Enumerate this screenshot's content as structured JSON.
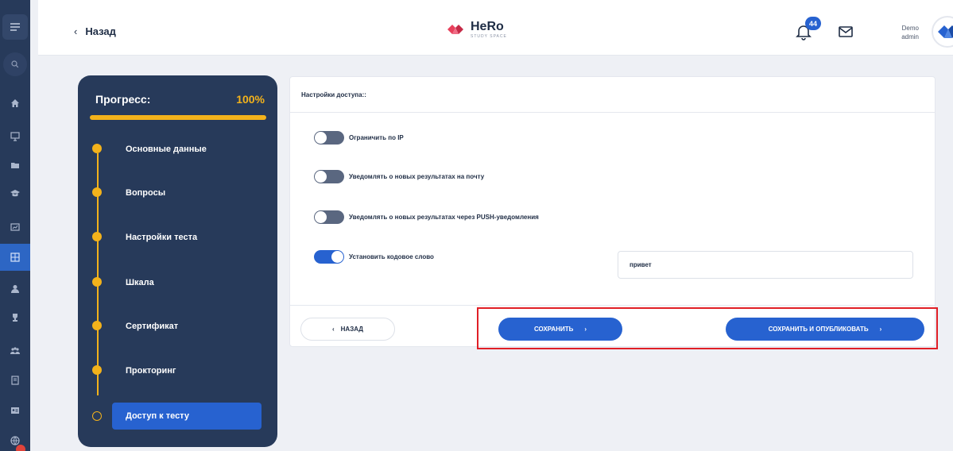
{
  "header": {
    "back_label": "Назад",
    "logo_name": "HeRo",
    "logo_sub": "STUDY SPACE",
    "notifications_count": "44",
    "user_line1": "Demo",
    "user_line2": "admin"
  },
  "progress": {
    "title": "Прогресс:",
    "percent": "100%",
    "steps": [
      {
        "label": "Основные данные",
        "done": true
      },
      {
        "label": "Вопросы",
        "done": true
      },
      {
        "label": "Настройки теста",
        "done": true
      },
      {
        "label": "Шкала",
        "done": true
      },
      {
        "label": "Сертификат",
        "done": true
      },
      {
        "label": "Прокторинг",
        "done": true
      },
      {
        "label": "Доступ к тесту",
        "done": false,
        "active": true
      }
    ]
  },
  "card": {
    "title": "Настройки доступа::",
    "toggles": [
      {
        "label": "Ограничить по IP",
        "on": false
      },
      {
        "label": "Уведомлять о новых результатах на почту",
        "on": false
      },
      {
        "label": "Уведомлять о новых результатах через PUSH-уведомления",
        "on": false
      },
      {
        "label": "Установить кодовое слово",
        "on": true
      }
    ],
    "code_word_value": "привет",
    "buttons": {
      "back": "НАЗАД",
      "save": "СОХРАНИТЬ",
      "save_publish": "СОХРАНИТЬ И ОПУБЛИКОВАТЬ"
    }
  },
  "colors": {
    "accent": "#2762d0",
    "progress": "#f3b21b",
    "panel": "#273a5a",
    "highlight": "#e01f26"
  },
  "rail_icons": [
    "menu-icon",
    "search-icon",
    "home-icon",
    "monitor-icon",
    "folder-icon",
    "graduation-cap-icon",
    "presentation-icon",
    "grid-icon",
    "user-icon",
    "trophy-icon",
    "users-icon",
    "book-icon",
    "id-card-icon",
    "globe-icon"
  ]
}
